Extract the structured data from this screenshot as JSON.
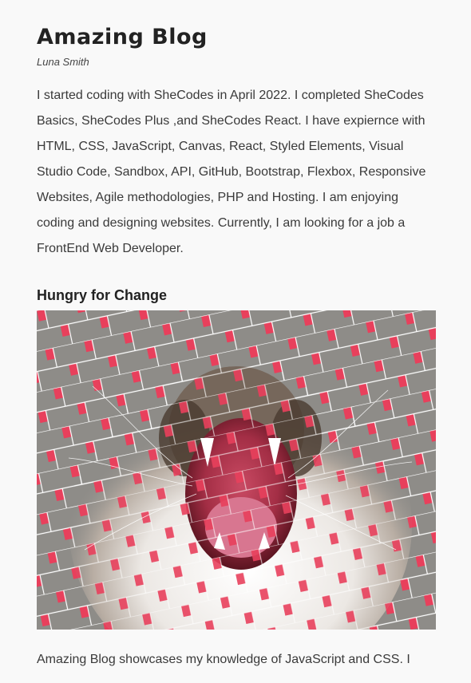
{
  "blog": {
    "title": "Amazing Blog",
    "author": "Luna Smith",
    "intro": "I started coding with SheCodes in April 2022. I completed SheCodes Basics, SheCodes Plus ,and SheCodes React. I have expiernce with HTML, CSS, JavaScript, Canvas, React, Styled Elements, Visual Studio Code, Sandbox, API, GitHub, Bootstrap, Flexbox, Responsive Websites, Agile methodologies, PHP and Hosting. I am enjoying coding and designing websites. Currently, I am looking for a job a FrontEnd Web Developer."
  },
  "post": {
    "title": "Hungry for Change",
    "image_alt": "Woven collage of a yawning cat",
    "text": "Amazing Blog showcases my knowledge of JavaScript and CSS. I"
  },
  "colors": {
    "background": "#f9f9f9",
    "accent": "#e8405c",
    "weave": "#8e8c88"
  }
}
